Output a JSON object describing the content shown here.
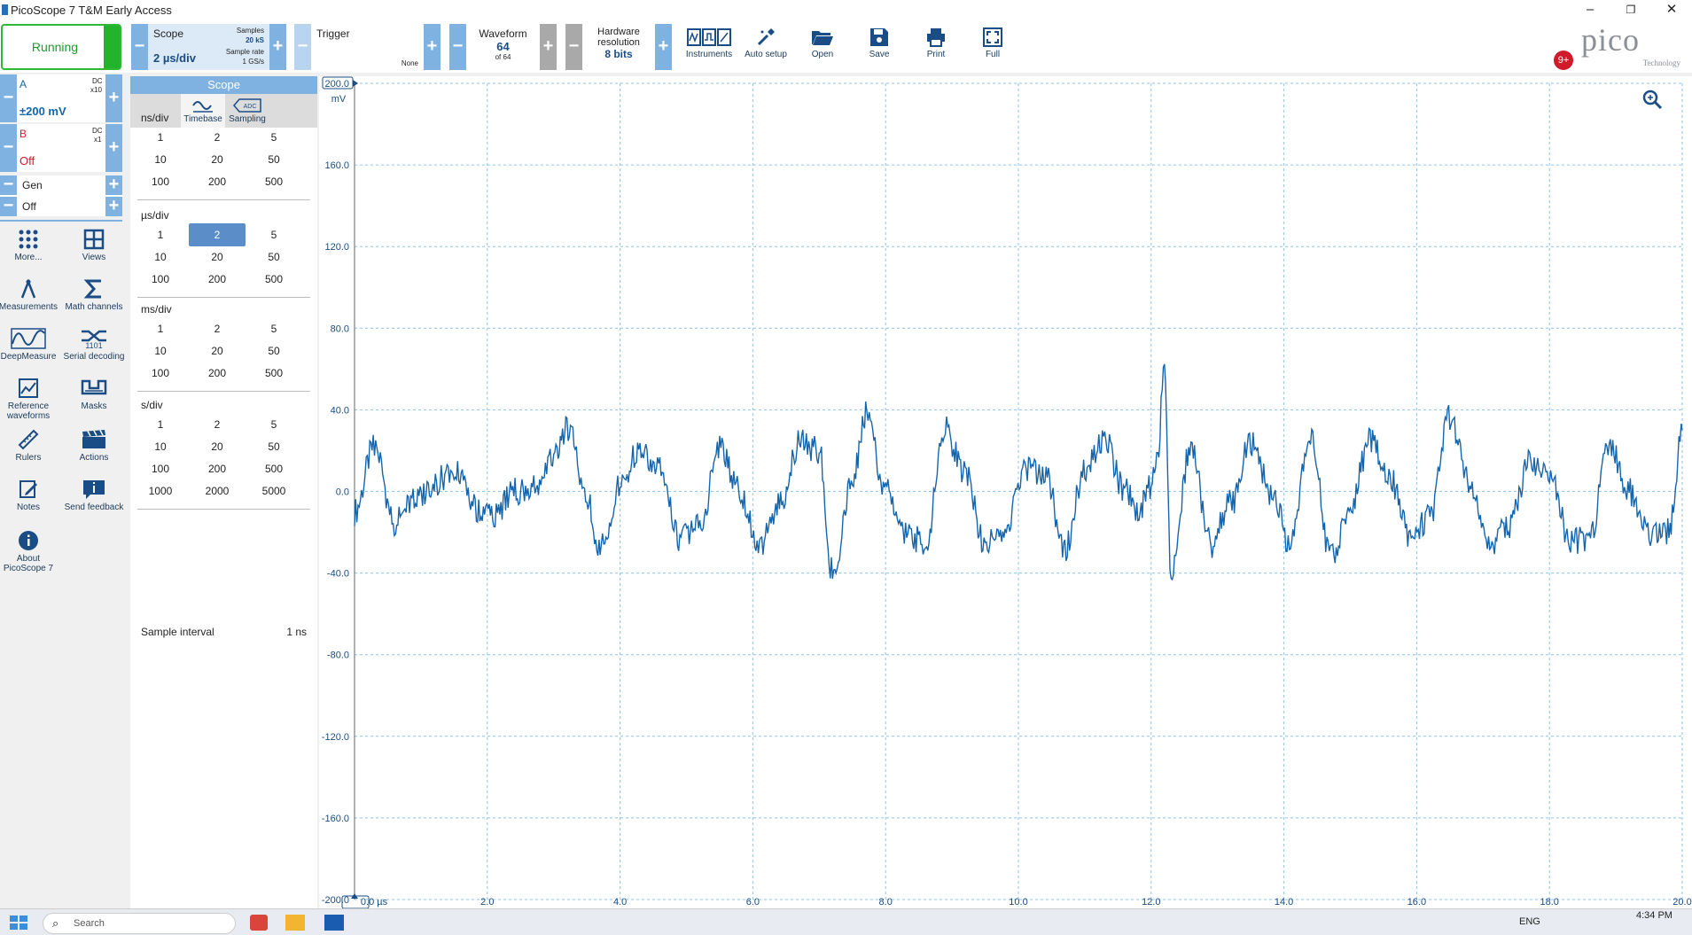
{
  "window": {
    "title": "PicoScope 7 T&M Early Access",
    "controls": [
      "–",
      "❐",
      "✕"
    ]
  },
  "toolbar": {
    "run_state": "Running",
    "scope": {
      "label": "Scope",
      "timebase": "2 µs/div",
      "samples_label": "Samples",
      "samples_value": "20 kS",
      "rate_label": "Sample rate",
      "rate_value": "1 GS/s"
    },
    "trigger": {
      "label": "Trigger",
      "mode": "None"
    },
    "waveform": {
      "label": "Waveform",
      "current": "64",
      "total": "of 64"
    },
    "hw_resolution": {
      "label_line1": "Hardware",
      "label_line2": "resolution",
      "value": "8 bits"
    },
    "tools": [
      {
        "icon": "instruments-icon",
        "label": "Instruments"
      },
      {
        "icon": "auto-setup-icon",
        "label": "Auto setup"
      },
      {
        "icon": "folder-open-icon",
        "label": "Open"
      },
      {
        "icon": "save-icon",
        "label": "Save"
      },
      {
        "icon": "print-icon",
        "label": "Print"
      },
      {
        "icon": "fullscreen-icon",
        "label": "Full"
      }
    ],
    "notification_badge": "9+",
    "logo_text": "pico",
    "logo_sub": "Technology"
  },
  "channels": {
    "a": {
      "name": "A",
      "coupling": "DC",
      "probe": "x10",
      "range": "±200 mV",
      "color": "#1565ad"
    },
    "b": {
      "name": "B",
      "coupling": "DC",
      "probe": "x1",
      "range": "Off",
      "color": "#d11a2a"
    },
    "gen": {
      "name": "Gen",
      "state": "Off"
    }
  },
  "sidebar": [
    {
      "icon": "more-icon",
      "label": "More..."
    },
    {
      "icon": "views-icon",
      "label": "Views"
    },
    {
      "icon": "measurements-icon",
      "label": "Measurements"
    },
    {
      "icon": "math-channels-icon",
      "label": "Math channels"
    },
    {
      "icon": "deepmeasure-icon",
      "label": "DeepMeasure"
    },
    {
      "icon": "serial-decoding-icon",
      "label": "Serial decoding"
    },
    {
      "icon": "reference-waveforms-icon",
      "label": "Reference\nwaveforms"
    },
    {
      "icon": "masks-icon",
      "label": "Masks"
    },
    {
      "icon": "rulers-icon",
      "label": "Rulers"
    },
    {
      "icon": "actions-icon",
      "label": "Actions"
    },
    {
      "icon": "notes-icon",
      "label": "Notes"
    },
    {
      "icon": "send-feedback-icon",
      "label": "Send feedback"
    },
    {
      "icon": "about-icon",
      "label": "About\nPicoScope 7"
    }
  ],
  "scope_panel": {
    "title": "Scope",
    "tabs": [
      "Timebase",
      "Sampling"
    ],
    "groups": [
      {
        "unit": "ns/div",
        "values": [
          "1",
          "2",
          "5",
          "10",
          "20",
          "50",
          "100",
          "200",
          "500"
        ]
      },
      {
        "unit": "µs/div",
        "values": [
          "1",
          "2",
          "5",
          "10",
          "20",
          "50",
          "100",
          "200",
          "500"
        ]
      },
      {
        "unit": "ms/div",
        "values": [
          "1",
          "2",
          "5",
          "10",
          "20",
          "50",
          "100",
          "200",
          "500"
        ]
      },
      {
        "unit": "s/div",
        "values": [
          "1",
          "2",
          "5",
          "10",
          "20",
          "50",
          "100",
          "200",
          "500",
          "1000",
          "2000",
          "5000"
        ]
      }
    ],
    "selected": {
      "group": 1,
      "value": "2"
    },
    "sample_interval_label": "Sample interval",
    "sample_interval_value": "1 ns"
  },
  "taskbar": {
    "search_placeholder": "Search",
    "lang": "ENG",
    "time": "4:34 PM"
  },
  "chart_data": {
    "type": "line",
    "ylabel": "mV",
    "xlabel": "",
    "xunit_first": "0.0 µs",
    "ylim": [
      -200,
      200
    ],
    "xlim": [
      0,
      20
    ],
    "yticks": [
      "200.0",
      "160.0",
      "120.0",
      "80.0",
      "40.0",
      "0.0",
      "-40.0",
      "-80.0",
      "-120.0",
      "-160.0",
      "-200.0"
    ],
    "xticks": [
      "0.0 µs",
      "2.0",
      "4.0",
      "6.0",
      "8.0",
      "10.0",
      "12.0",
      "14.0",
      "16.0",
      "18.0",
      "20.0"
    ],
    "grid": true,
    "series": [
      {
        "color": "#1565ad",
        "x": [
          0,
          0.3,
          0.6,
          0.9,
          1.2,
          1.5,
          1.8,
          2.1,
          2.4,
          2.7,
          3.0,
          3.2,
          3.5,
          3.7,
          4.0,
          4.3,
          4.6,
          4.9,
          5.2,
          5.5,
          5.8,
          6.1,
          6.4,
          6.7,
          7.0,
          7.2,
          7.5,
          7.7,
          8.0,
          8.3,
          8.6,
          8.9,
          9.2,
          9.5,
          9.8,
          10.1,
          10.4,
          10.7,
          11.0,
          11.3,
          11.6,
          11.8,
          12.0,
          12.1,
          12.2,
          12.3,
          12.6,
          12.9,
          13.2,
          13.5,
          13.8,
          14.1,
          14.4,
          14.7,
          15.0,
          15.3,
          15.6,
          15.9,
          16.2,
          16.5,
          16.8,
          17.1,
          17.4,
          17.7,
          18.0,
          18.3,
          18.6,
          18.9,
          19.2,
          19.5,
          19.8,
          20.0
        ],
        "y": [
          -10,
          22,
          -15,
          -5,
          4,
          12,
          -8,
          -12,
          0,
          2,
          15,
          32,
          -5,
          -28,
          2,
          22,
          10,
          -24,
          -18,
          22,
          0,
          -27,
          -6,
          24,
          20,
          -40,
          5,
          38,
          2,
          -22,
          -25,
          30,
          8,
          -26,
          -20,
          12,
          8,
          -28,
          10,
          25,
          0,
          -10,
          2,
          20,
          60,
          -40,
          22,
          -26,
          -6,
          24,
          0,
          -26,
          30,
          -32,
          -8,
          26,
          6,
          -22,
          -12,
          36,
          6,
          -26,
          -16,
          14,
          10,
          -24,
          -24,
          24,
          0,
          -22,
          -20,
          30
        ]
      }
    ]
  }
}
